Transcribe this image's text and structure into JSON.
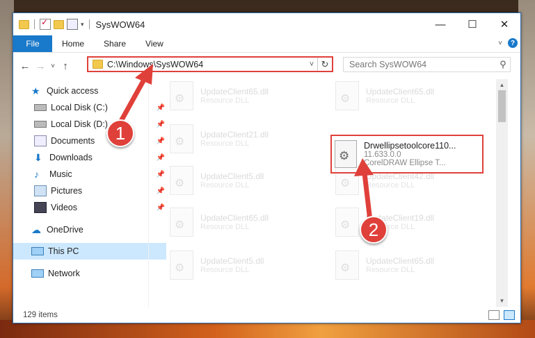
{
  "window": {
    "title": "SysWOW64",
    "caption": {
      "minimize": "—",
      "maximize": "☐",
      "close": "✕"
    }
  },
  "ribbon": {
    "file": "File",
    "tabs": [
      "Home",
      "Share",
      "View"
    ],
    "help": "?"
  },
  "nav": {
    "back": "←",
    "forward": "→",
    "recent": "˅",
    "up": "↑",
    "address": "C:\\Windows\\SysWOW64",
    "search_placeholder": "Search SysWOW64"
  },
  "sidebar": {
    "items": [
      {
        "label": "Quick access",
        "icon": "star-icon"
      },
      {
        "label": "Local Disk (C:)",
        "icon": "drive-icon",
        "pinned": true
      },
      {
        "label": "Local Disk (D:)",
        "icon": "drive-icon",
        "pinned": true
      },
      {
        "label": "Documents",
        "icon": "documents-icon",
        "pinned": true
      },
      {
        "label": "Downloads",
        "icon": "download-icon",
        "pinned": true
      },
      {
        "label": "Music",
        "icon": "music-icon",
        "pinned": true
      },
      {
        "label": "Pictures",
        "icon": "pictures-icon",
        "pinned": true
      },
      {
        "label": "Videos",
        "icon": "videos-icon",
        "pinned": true
      },
      {
        "label": "OneDrive",
        "icon": "cloud-icon"
      },
      {
        "label": "This PC",
        "icon": "computer-icon",
        "selected": true
      },
      {
        "label": "Network",
        "icon": "network-icon"
      }
    ]
  },
  "files": {
    "ghosts": [
      {
        "name": "UpdateClient65.dll",
        "type": "Resource DLL"
      },
      {
        "name": "UpdateClient65.dll",
        "type": "Resource DLL"
      },
      {
        "name": "UpdateClient21.dll",
        "type": "Resource DLL"
      },
      {
        "name": "UpdateClient5.dll",
        "type": "Resource DLL"
      },
      {
        "name": "UpdateClient42.dll",
        "type": "Resource DLL"
      },
      {
        "name": "UpdateClient65.dll",
        "type": "Resource DLL"
      },
      {
        "name": "UpdateClient19.dll",
        "type": "Resource DLL"
      },
      {
        "name": "UpdateClient5.dll",
        "type": "Resource DLL"
      },
      {
        "name": "UpdateClient65.dll",
        "type": "Resource DLL"
      }
    ],
    "highlighted": {
      "name": "Drwellipsetoolcore110...",
      "version": "11.633.0.0",
      "description": "CorelDRAW Ellipse T..."
    }
  },
  "status": {
    "count": "129 items"
  },
  "annotations": {
    "step1": "1",
    "step2": "2",
    "color": "#e0403a"
  }
}
